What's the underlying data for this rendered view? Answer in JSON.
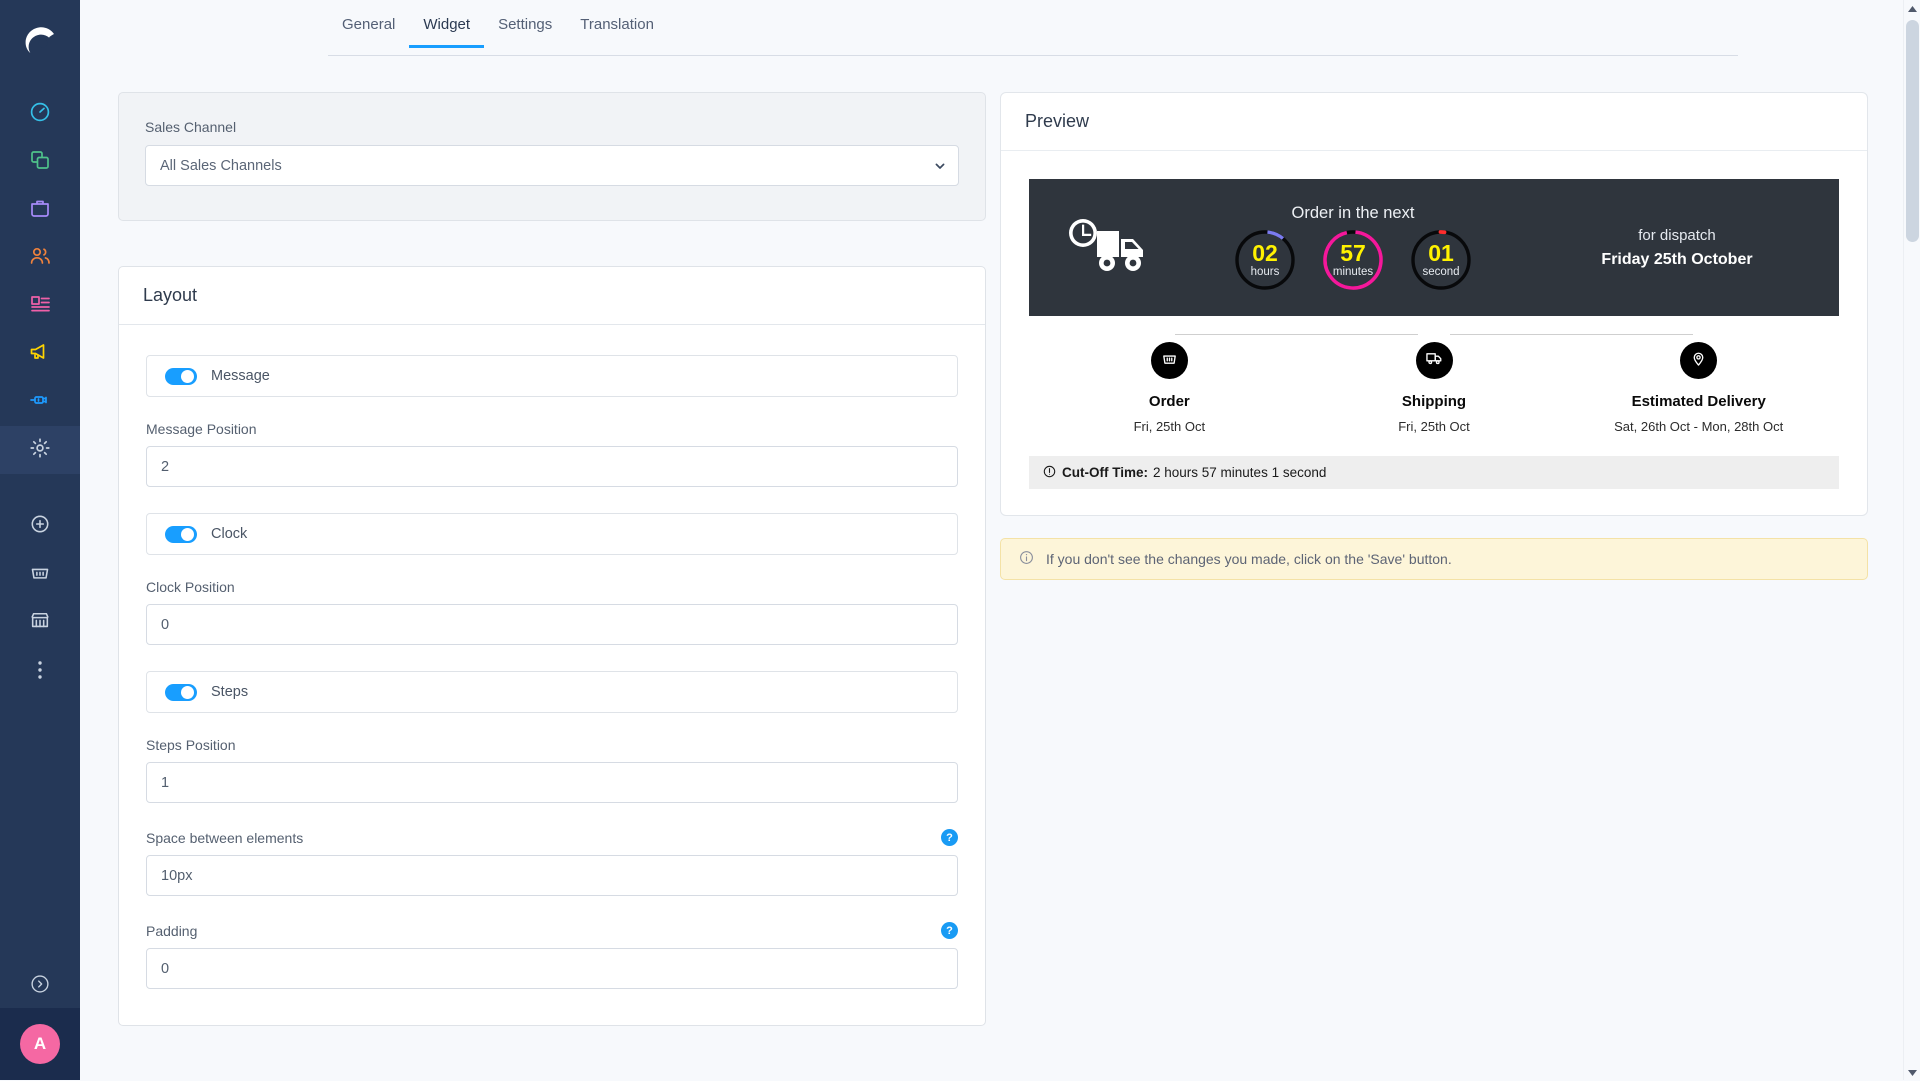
{
  "sidebar": {
    "logo_name": "shopify-style-logo",
    "items": [
      {
        "name": "dashboard",
        "icon": "speedometer-icon",
        "color": "#35c0e8",
        "active": false
      },
      {
        "name": "products",
        "icon": "copy-squares-icon",
        "color": "#4fc28a",
        "active": false
      },
      {
        "name": "orders",
        "icon": "briefcase-icon",
        "color": "#a78bfa",
        "active": false
      },
      {
        "name": "customers",
        "icon": "people-icon",
        "color": "#f0823c",
        "active": false
      },
      {
        "name": "content",
        "icon": "article-icon",
        "color": "#f060a8",
        "active": false
      },
      {
        "name": "marketing",
        "icon": "megaphone-icon",
        "color": "#ffd400",
        "active": false
      },
      {
        "name": "apps",
        "icon": "plug-icon",
        "color": "#1e9bff",
        "active": false
      },
      {
        "name": "settings",
        "icon": "gear-icon",
        "color": "#c9d3e0",
        "active": true
      },
      {
        "name": "add",
        "icon": "plus-circle-icon",
        "color": "#c9d3e0",
        "active": false
      },
      {
        "name": "basket",
        "icon": "basket-icon",
        "color": "#c9d3e0",
        "active": false
      },
      {
        "name": "store",
        "icon": "store-icon",
        "color": "#c9d3e0",
        "active": false
      },
      {
        "name": "more",
        "icon": "more-vertical-icon",
        "color": "#c9d3e0",
        "active": false
      }
    ],
    "collapse_icon": "chevron-right-circle-icon",
    "avatar_initial": "A",
    "avatar_color": "#f568a3"
  },
  "tabs": [
    {
      "label": "General",
      "active": false
    },
    {
      "label": "Widget",
      "active": true
    },
    {
      "label": "Settings",
      "active": false
    },
    {
      "label": "Translation",
      "active": false
    }
  ],
  "sales_channel": {
    "label": "Sales Channel",
    "value": "All Sales Channels",
    "chevron_icon": "chevron-down-icon"
  },
  "layout_panel": {
    "title": "Layout",
    "rows": [
      {
        "toggle_label": "Message",
        "toggle_on": true,
        "field_label": "Message Position",
        "field_value": "2",
        "help": false
      },
      {
        "toggle_label": "Clock",
        "toggle_on": true,
        "field_label": "Clock Position",
        "field_value": "0",
        "help": false
      },
      {
        "toggle_label": "Steps",
        "toggle_on": true,
        "field_label": "Steps Position",
        "field_value": "1",
        "help": false
      }
    ],
    "extra_fields": [
      {
        "label": "Space between elements",
        "value": "10px",
        "help": true,
        "help_glyph": "?"
      },
      {
        "label": "Padding",
        "value": "0",
        "help": true,
        "help_glyph": "?"
      }
    ]
  },
  "preview": {
    "title": "Preview",
    "banner": {
      "truck_icon": "truck-clock-icon",
      "headline": "Order in the next",
      "counters": [
        {
          "value": "02",
          "unit": "hours",
          "ring_color": "#7b7bf0",
          "ring_pct": 10,
          "number_color": "#fff200"
        },
        {
          "value": "57",
          "unit": "minutes",
          "ring_color": "#f5189b",
          "ring_pct": 95,
          "number_color": "#fff200"
        },
        {
          "value": "01",
          "unit": "second",
          "ring_color": "#ff2d2d",
          "ring_pct": 2,
          "number_color": "#fff200"
        }
      ],
      "dispatch_prefix": "for dispatch",
      "dispatch_date": "Friday 25th October"
    },
    "steps": [
      {
        "icon": "basket-icon",
        "name": "Order",
        "date": "Fri, 25th Oct"
      },
      {
        "icon": "truck-icon",
        "name": "Shipping",
        "date": "Fri, 25th Oct"
      },
      {
        "icon": "location-pin-icon",
        "name": "Estimated Delivery",
        "date": "Sat, 26th Oct - Mon, 28th Oct"
      }
    ],
    "cutoff": {
      "icon": "alert-circle-icon",
      "label": "Cut-Off Time:",
      "value": "2 hours 57 minutes 1 second"
    }
  },
  "notice": {
    "icon": "info-circle-icon",
    "text": "If you don't see the changes you made, click on the 'Save' button."
  },
  "scrollbar": {
    "up_icon": "caret-up-icon",
    "down_icon": "caret-down-icon"
  }
}
